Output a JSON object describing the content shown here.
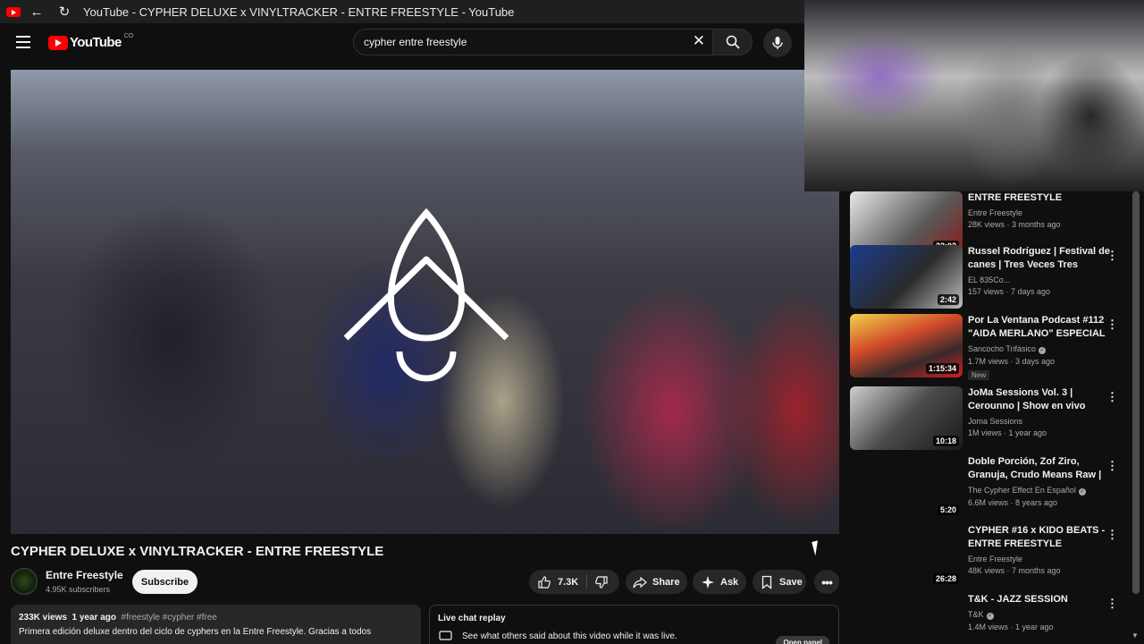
{
  "browser": {
    "tab_title": "YouTube - CYPHER DELUXE x VINYLTRACKER - ENTRE FREESTYLE - YouTube",
    "back_icon": "back-arrow-icon",
    "reload_icon": "reload-icon"
  },
  "masthead": {
    "logo_text": "YouTube",
    "logo_region": "CO",
    "search_value": "cypher entre freestyle",
    "clear_icon": "close-icon",
    "search_icon": "search-icon",
    "mic_icon": "microphone-icon"
  },
  "video": {
    "title": "CYPHER DELUXE x VINYLTRACKER - ENTRE FREESTYLE",
    "channel": "Entre Freestyle",
    "subscribers": "4.95K subscribers",
    "subscribe_label": "Subscribe",
    "likes": "7.3K",
    "share_label": "Share",
    "ask_label": "Ask",
    "save_label": "Save"
  },
  "description": {
    "views": "233K views",
    "age": "1 year ago",
    "tags": "#freestyle #cypher #free",
    "text": "Primera edición deluxe dentro del ciclo de cyphers en la Entre Freestyle. Gracias a todos"
  },
  "chat": {
    "title": "Live chat replay",
    "text": "See what others said about this video while it was live.",
    "open_label": "Open panel"
  },
  "recommendations": [
    {
      "title": "ENTRE FREESTYLE",
      "channel": "Entre Freestyle",
      "stats": "28K views · 3 months ago",
      "duration": "22:02",
      "verified": false,
      "badge": ""
    },
    {
      "title": "Russel Rodríguez | Festival de canes | Tres Veces Tres",
      "channel": "EL 835Co...",
      "stats": "157 views · 7 days ago",
      "duration": "2:42",
      "verified": false,
      "badge": ""
    },
    {
      "title": "Por La Ventana Podcast #112 \"AIDA MERLANO\" ESPECIAL ...",
      "channel": "Sancocho Trifásico",
      "stats": "1.7M views · 3 days ago",
      "duration": "1:15:34",
      "verified": true,
      "badge": "New"
    },
    {
      "title": "JoMa Sessions Vol. 3 | Cerounno | Show en vivo",
      "channel": "Joma Sessions",
      "stats": "1M views · 1 year ago",
      "duration": "10:18",
      "verified": false,
      "badge": ""
    },
    {
      "title": "Doble Porción, Zof Ziro, Granuja, Crudo Means Raw | THE ...",
      "channel": "The Cypher Effect En Español",
      "stats": "6.6M views · 8 years ago",
      "duration": "5:20",
      "verified": true,
      "badge": ""
    },
    {
      "title": "CYPHER #16 x KIDO BEATS - ENTRE FREESTYLE",
      "channel": "Entre Freestyle",
      "stats": "48K views · 7 months ago",
      "duration": "26:28",
      "verified": false,
      "badge": ""
    },
    {
      "title": "T&K - JAZZ SESSION",
      "channel": "T&K",
      "stats": "1.4M views · 1 year ago",
      "duration": "",
      "verified": true,
      "badge": ""
    }
  ],
  "colors": {
    "background": "#0f0f0f",
    "surface": "#272727",
    "brand_red": "#ff0000",
    "text_primary": "#f1f1f1",
    "text_secondary": "#aaaaaa"
  }
}
